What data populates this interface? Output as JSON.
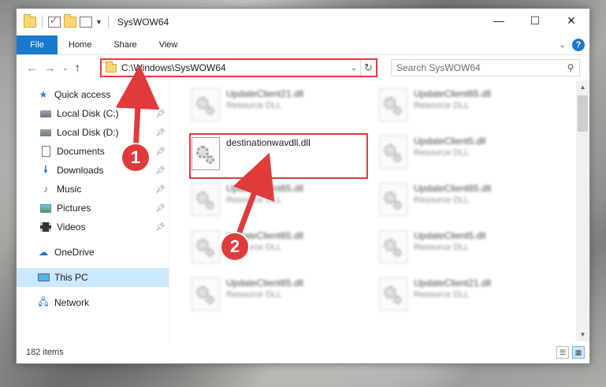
{
  "window": {
    "title": "SysWOW64",
    "minimize": "—",
    "maximize": "☐",
    "close": "✕"
  },
  "ribbon": {
    "tabs": [
      "File",
      "Home",
      "Share",
      "View"
    ],
    "help": "?",
    "expand": "⌄"
  },
  "address": {
    "path": "C:\\Windows\\SysWOW64",
    "dropdown": "⌄",
    "refresh": "↻"
  },
  "search": {
    "placeholder": "Search SysWOW64"
  },
  "nav_buttons": {
    "back": "←",
    "forward": "→",
    "recent": "⌄",
    "up": "↑"
  },
  "sidebar": {
    "quick_access": "Quick access",
    "pinned": [
      {
        "label": "Local Disk (C:)",
        "icon": "disk-icon"
      },
      {
        "label": "Local Disk (D:)",
        "icon": "disk-icon"
      },
      {
        "label": "Documents",
        "icon": "documents-icon"
      },
      {
        "label": "Downloads",
        "icon": "downloads-icon"
      },
      {
        "label": "Music",
        "icon": "music-icon"
      },
      {
        "label": "Pictures",
        "icon": "pictures-icon"
      },
      {
        "label": "Videos",
        "icon": "videos-icon"
      }
    ],
    "onedrive": "OneDrive",
    "this_pc": "This PC",
    "network": "Network"
  },
  "files": {
    "left": [
      {
        "name": "UpdateClient21.dll",
        "type": "Resource DLL"
      },
      {
        "name": "destinationwavdll.dll",
        "type": ""
      },
      {
        "name": "UpdateClient65.dll",
        "type": "Resource DLL"
      },
      {
        "name": "UpdateClient65.dll",
        "type": "Resource DLL"
      },
      {
        "name": "UpdateClient65.dll",
        "type": "Resource DLL"
      }
    ],
    "right": [
      {
        "name": "UpdateClient65.dll",
        "type": "Resource DLL"
      },
      {
        "name": "UpdateClient5.dll",
        "type": "Resource DLL"
      },
      {
        "name": "UpdateClient65.dll",
        "type": "Resource DLL"
      },
      {
        "name": "UpdateClient5.dll",
        "type": "Resource DLL"
      },
      {
        "name": "UpdateClient21.dll",
        "type": "Resource DLL"
      }
    ]
  },
  "status": {
    "item_count": "182 items"
  },
  "annotations": {
    "step1": "1",
    "step2": "2",
    "color": "#e03b3b"
  }
}
